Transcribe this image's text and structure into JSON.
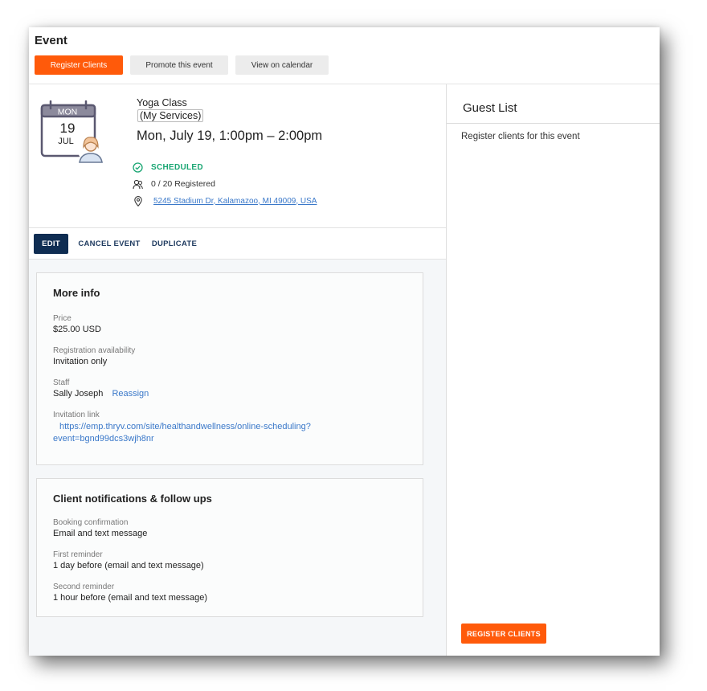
{
  "header": {
    "title": "Event",
    "register_label": "Register Clients",
    "promote_label": "Promote this event",
    "calendar_label": "View on calendar"
  },
  "event": {
    "weekday": "MON",
    "day": "19",
    "month": "JUL",
    "name": "Yoga Class",
    "service": "(My Services)",
    "datetime": "Mon, July 19, 1:00pm – 2:00pm",
    "status": "SCHEDULED",
    "registered": "0 / 20 Registered",
    "address": "5245 Stadium Dr, Kalamazoo, MI 49009, USA"
  },
  "actions": {
    "edit": "EDIT",
    "cancel": "CANCEL EVENT",
    "duplicate": "DUPLICATE"
  },
  "more_info": {
    "title": "More info",
    "price_label": "Price",
    "price_value": "$25.00 USD",
    "availability_label": "Registration availability",
    "availability_value": "Invitation only",
    "staff_label": "Staff",
    "staff_value": "Sally Joseph",
    "reassign": "Reassign",
    "invite_label": "Invitation link",
    "invite_line1": "https://emp.thryv.com/site/healthandwellness/online-scheduling?",
    "invite_line2": "event=bgnd99dcs3wjh8nr"
  },
  "notifications": {
    "title": "Client notifications & follow ups",
    "confirm_label": "Booking confirmation",
    "confirm_value": "Email and text message",
    "first_label": "First reminder",
    "first_value": "1 day before (email and text message)",
    "second_label": "Second reminder",
    "second_value": "1 hour before (email and text message)"
  },
  "guest_list": {
    "title": "Guest List",
    "subtitle": "Register clients for this event",
    "button": "REGISTER CLIENTS"
  },
  "colors": {
    "accent": "#ff5a0a",
    "navy": "#0f2d52",
    "status_green": "#1aa673",
    "link": "#3a78c9"
  },
  "icons": {
    "calendar": "calendar-icon",
    "avatar": "person-avatar-icon",
    "status": "check-circle-icon",
    "registered": "people-icon",
    "address": "location-pin-icon"
  }
}
